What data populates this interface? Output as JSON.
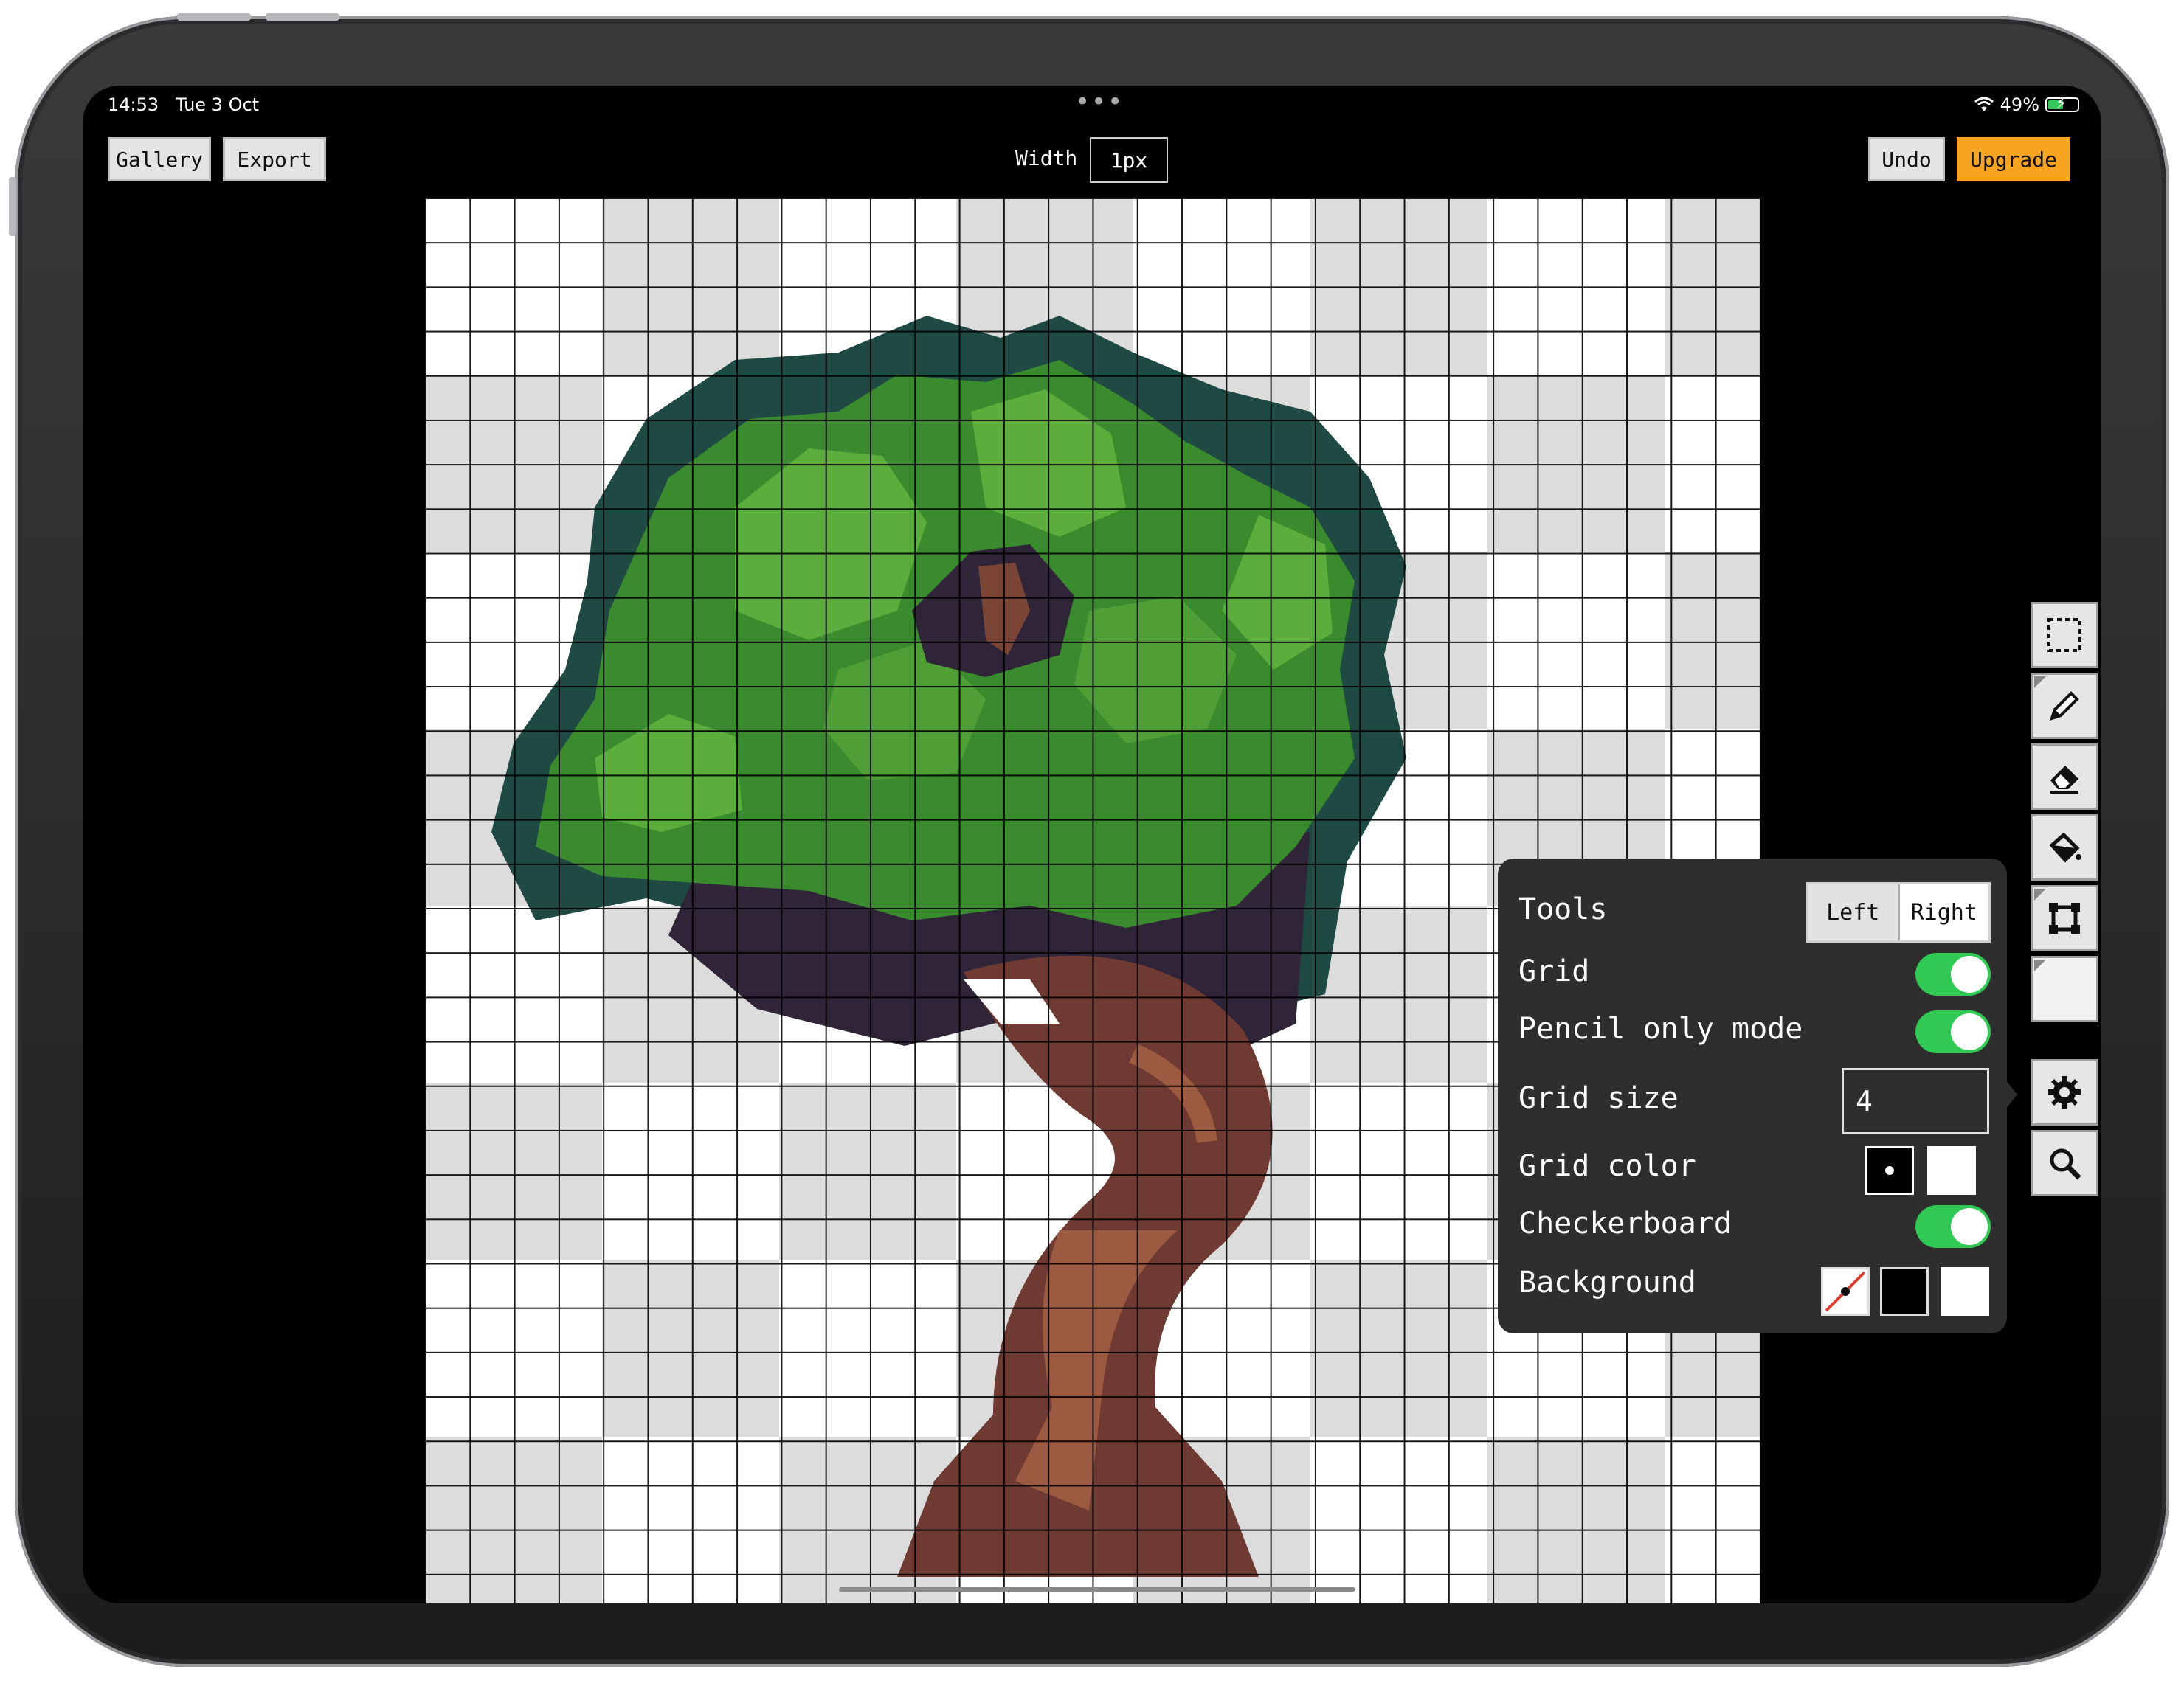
{
  "status": {
    "time": "14:53",
    "date": "Tue 3 Oct",
    "battery": "49%",
    "multitask": "•••"
  },
  "toolbar": {
    "gallery": "Gallery",
    "export": "Export",
    "width_label": "Width",
    "width_value": "1px",
    "undo": "Undo",
    "upgrade": "Upgrade"
  },
  "colors": {
    "accent": "#f7a521",
    "toggle_on": "#2fc954",
    "panel": "#2e2e2e"
  },
  "tools": [
    "selection-icon",
    "pencil-icon",
    "eraser-icon",
    "fill-bucket-icon",
    "transform-icon",
    "color-swatch"
  ],
  "dock_extra": [
    "settings-gear-icon",
    "zoom-icon"
  ],
  "settings": {
    "tools_label": "Tools",
    "tools_left": "Left",
    "tools_right": "Right",
    "tools_selected": "Right",
    "grid_label": "Grid",
    "grid_on": true,
    "pencil_label": "Pencil only mode",
    "pencil_on": true,
    "grid_size_label": "Grid size",
    "grid_size_value": "4",
    "grid_color_label": "Grid color",
    "grid_color_options": [
      "#000000",
      "#ffffff"
    ],
    "checkerboard_label": "Checkerboard",
    "checkerboard_on": true,
    "background_label": "Background",
    "background_options": [
      "transparent",
      "#000000",
      "#ffffff"
    ]
  }
}
